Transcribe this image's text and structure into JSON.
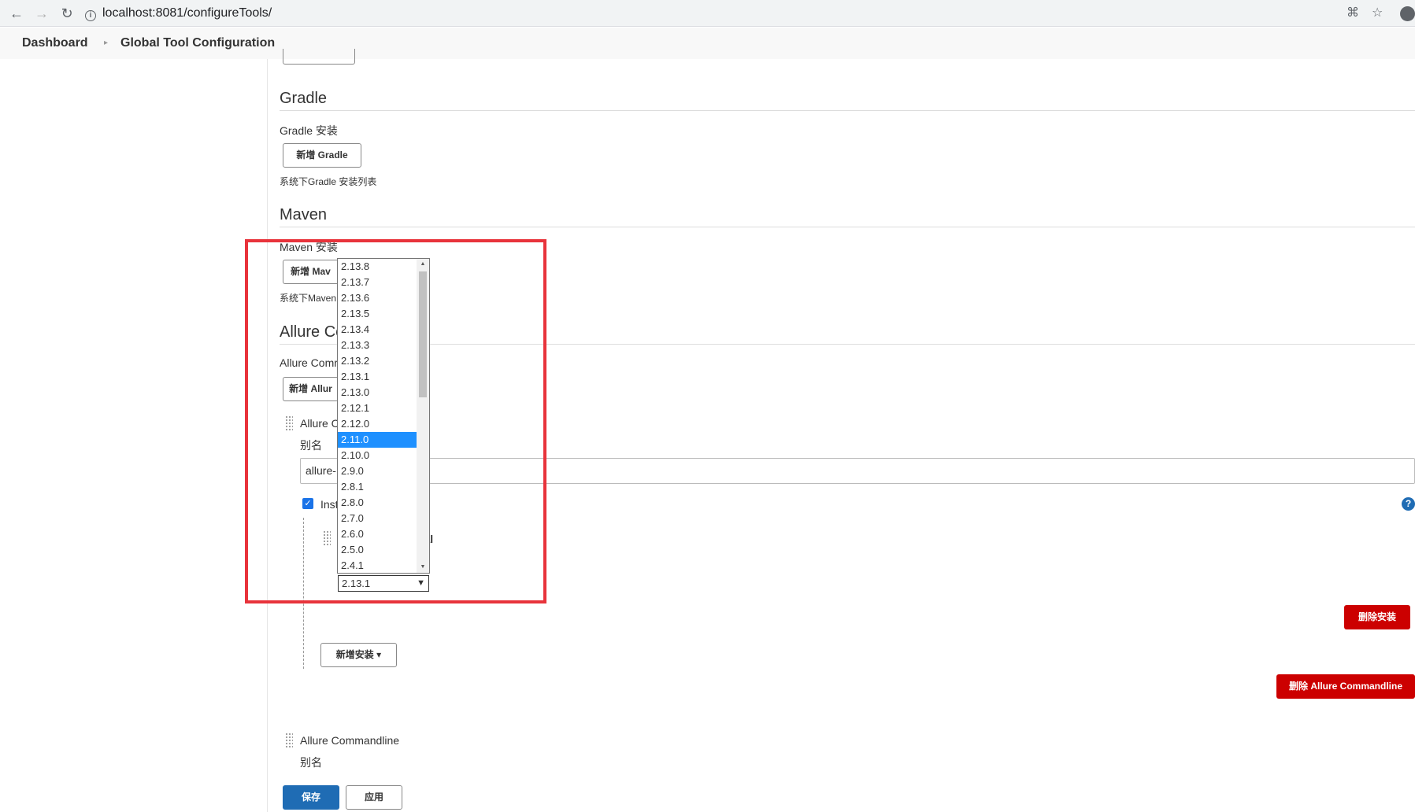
{
  "browser": {
    "url": "localhost:8081/configureTools/"
  },
  "breadcrumb": {
    "items": [
      "Dashboard",
      "Global Tool Configuration"
    ]
  },
  "gradle": {
    "title": "Gradle",
    "install_label": "Gradle 安装",
    "add_button": "新增 Gradle",
    "description": "系统下Gradle 安装列表"
  },
  "maven": {
    "title": "Maven",
    "install_label": "Maven 安装",
    "add_button": "新增 Mav",
    "description": "系统下Maven"
  },
  "allure": {
    "title": "Allure Co",
    "install_label": "Allure Comr",
    "add_button": "新增 Allur",
    "item_title": "Allure C",
    "alias_label": "别名",
    "alias_value": "allure-",
    "install_checkbox_label": "Inst",
    "installer_title_fragment": "ral",
    "version_selected": "2.13.1",
    "version_options": [
      "2.13.8",
      "2.13.7",
      "2.13.6",
      "2.13.5",
      "2.13.4",
      "2.13.3",
      "2.13.2",
      "2.13.1",
      "2.13.0",
      "2.12.1",
      "2.12.0",
      "2.11.0",
      "2.10.0",
      "2.9.0",
      "2.8.1",
      "2.8.0",
      "2.7.0",
      "2.6.0",
      "2.5.0",
      "2.4.1"
    ],
    "highlighted_option": "2.11.0",
    "delete_install_button": "删除安装",
    "add_install_button": "新增安装",
    "delete_allure_button": "删除 Allure Commandline",
    "item2_title": "Allure Commandline",
    "item2_alias_label": "别名"
  },
  "footer": {
    "save_button": "保存",
    "apply_button": "应用"
  },
  "colors": {
    "highlight_border": "#e8333b",
    "primary_blue": "#1f6cb4",
    "danger_red": "#cc0000",
    "selected_option": "#1e90ff"
  }
}
